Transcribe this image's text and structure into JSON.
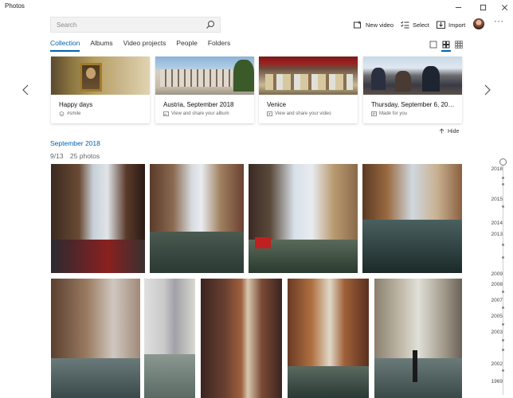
{
  "window": {
    "title": "Photos"
  },
  "search": {
    "placeholder": "Search"
  },
  "toolbar": {
    "new_video": "New video",
    "select": "Select",
    "import": "Import",
    "more": "···"
  },
  "tabs": [
    {
      "label": "Collection",
      "active": true
    },
    {
      "label": "Albums"
    },
    {
      "label": "Video projects"
    },
    {
      "label": "People"
    },
    {
      "label": "Folders"
    }
  ],
  "cards": [
    {
      "title": "Happy days",
      "subtitle": "#smile",
      "icon": "smile-icon"
    },
    {
      "title": "Austria, September 2018",
      "subtitle": "View and share your album",
      "icon": "album-icon"
    },
    {
      "title": "Venice",
      "subtitle": "View and share your video",
      "icon": "video-icon"
    },
    {
      "title": "Thursday, September 6, 20…",
      "subtitle": "Made for you",
      "icon": "made-for-you-icon"
    }
  ],
  "hide_label": "Hide",
  "section": {
    "title": "September 2018",
    "date": "9/13",
    "count": "25 photos"
  },
  "timeline": {
    "years": [
      "2018",
      "2015",
      "2014",
      "2013",
      "2009",
      "2008",
      "2007",
      "2005",
      "2003",
      "2002",
      "1969"
    ]
  },
  "colors": {
    "accent": "#0063b1"
  }
}
